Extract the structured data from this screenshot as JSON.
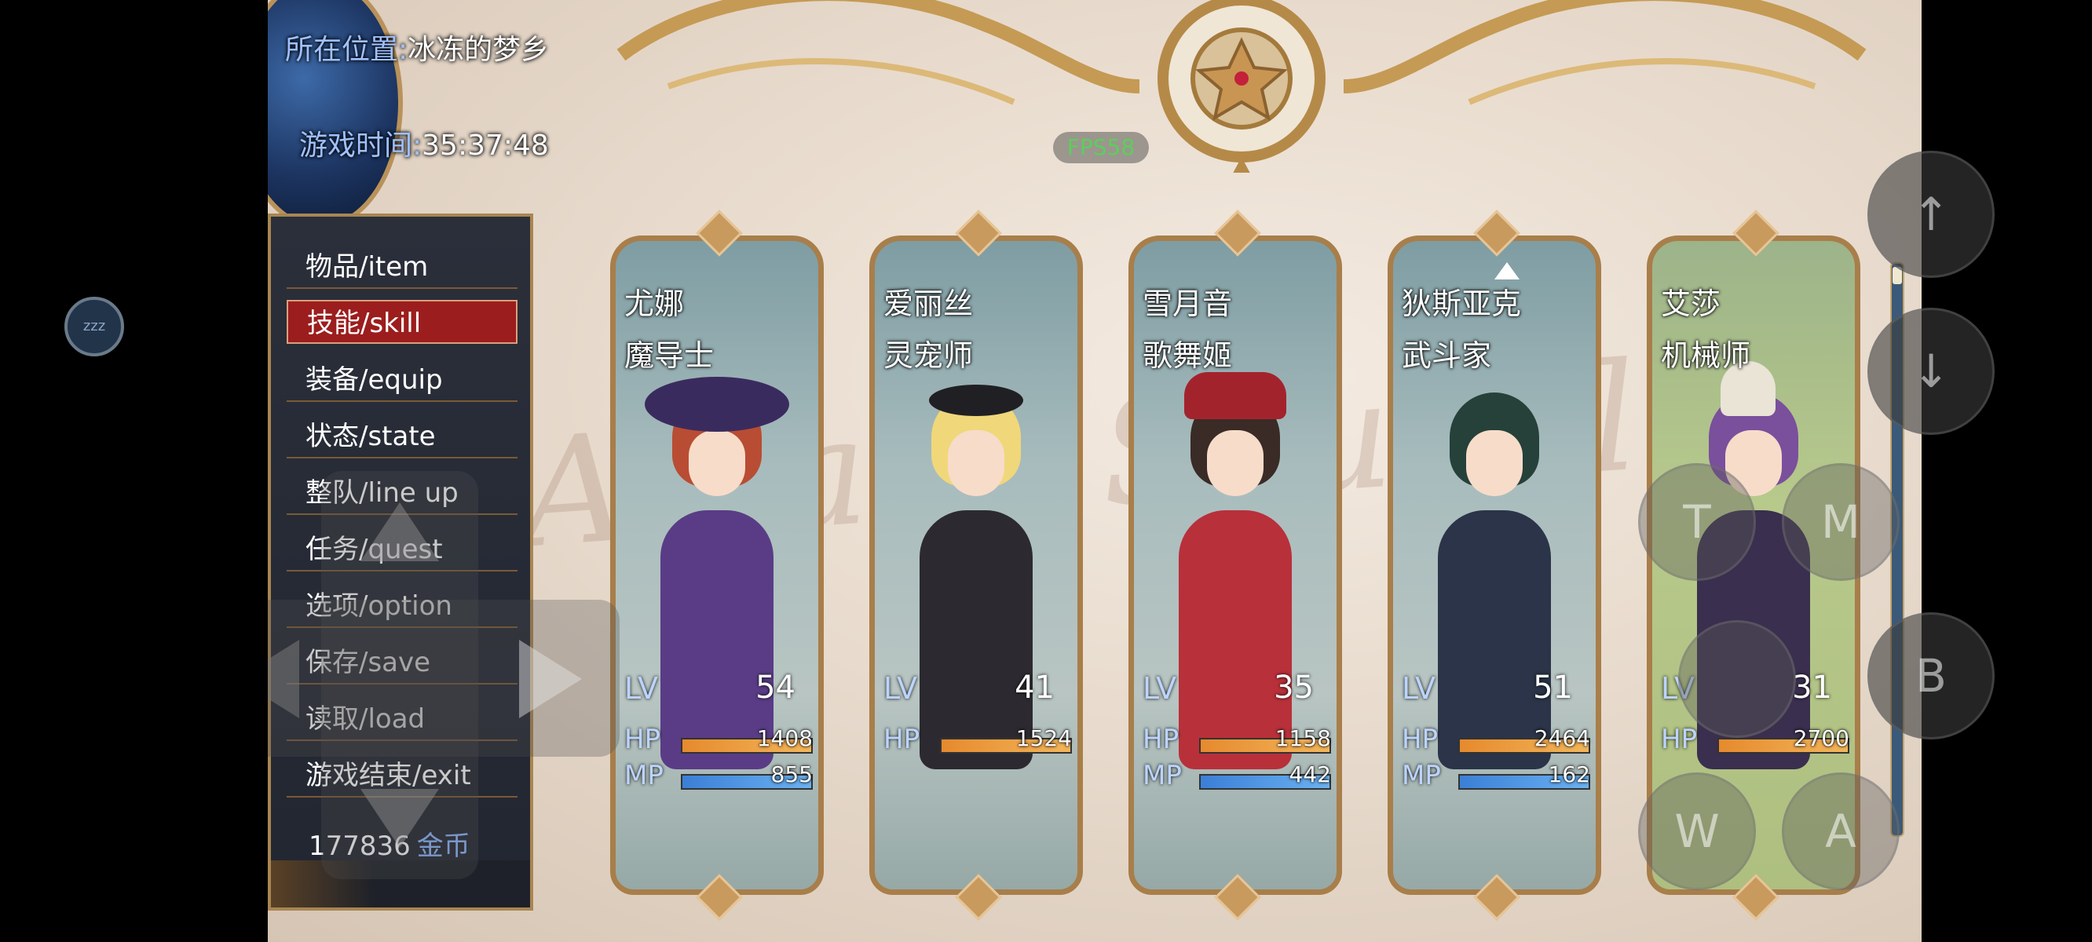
{
  "hud": {
    "location_label": "所在位置:",
    "location_value": "冰冻的梦乡",
    "time_label": "游戏时间:",
    "time_value": "35:37:48",
    "fps": "FPS58"
  },
  "float_button": {
    "label": "zzz"
  },
  "menu": {
    "items": [
      {
        "label": "物品/item"
      },
      {
        "label": "技能/skill",
        "selected": true
      },
      {
        "label": "装备/equip"
      },
      {
        "label": "状态/state"
      },
      {
        "label": "整队/line up"
      },
      {
        "label": "任务/quest"
      },
      {
        "label": "选项/option"
      },
      {
        "label": "保存/save"
      },
      {
        "label": "读取/load"
      },
      {
        "label": "游戏结束/exit"
      }
    ],
    "gold_value": "177836",
    "gold_unit": "金币"
  },
  "party": [
    {
      "name": "尤娜",
      "class": "魔导士",
      "lv_label": "LV",
      "lv": "54",
      "hp_label": "HP",
      "hp": "1408",
      "mp_label": "MP",
      "mp": "855",
      "hair": "#b84d33",
      "outfit": "#5a3c86",
      "hat": "#3a2b5e"
    },
    {
      "name": "爱丽丝",
      "class": "灵宠师",
      "lv_label": "LV",
      "lv": "41",
      "hp_label": "HP",
      "hp": "1524",
      "mp_label": "MP",
      "mp": "",
      "hair": "#f0d77a",
      "outfit": "#2c2a30",
      "hat": "#202024"
    },
    {
      "name": "雪月音",
      "class": "歌舞姬",
      "lv_label": "LV",
      "lv": "35",
      "hp_label": "HP",
      "hp": "1158",
      "mp_label": "MP",
      "mp": "442",
      "hair": "#3a2b26",
      "outfit": "#b8303a",
      "hat": "#a3232d"
    },
    {
      "name": "狄斯亚克",
      "class": "武斗家",
      "lv_label": "LV",
      "lv": "51",
      "hp_label": "HP",
      "hp": "2464",
      "mp_label": "MP",
      "mp": "162",
      "hair": "#26403a",
      "outfit": "#2b3448",
      "hat": ""
    },
    {
      "name": "艾莎",
      "class": "机械师",
      "lv_label": "LV",
      "lv": "31",
      "hp_label": "HP",
      "hp": "2700",
      "mp_label": "",
      "mp": "",
      "hair": "#7a4f9c",
      "outfit": "#3a2f4e",
      "hat": "#e9e4d6"
    }
  ],
  "controls": {
    "up": "↑",
    "down": "↓",
    "t": "T",
    "m": "M",
    "b": "B",
    "w": "W",
    "a": "A"
  },
  "colors": {
    "accent_gold": "#a88652",
    "menu_selected": "#9c1d1d",
    "hp_bar": "#e68a2e",
    "mp_bar": "#3b7fd6"
  }
}
